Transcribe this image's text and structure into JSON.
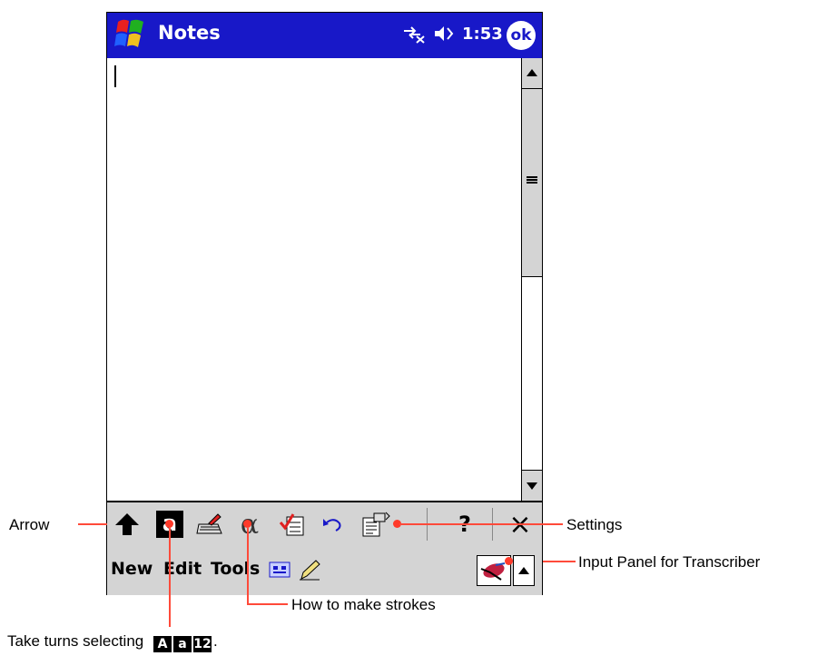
{
  "window": {
    "title": "Notes",
    "time": "1:53",
    "ok_label": "ok"
  },
  "transcriber_toolbar": {
    "tools": [
      {
        "name": "arrow",
        "icon": "up-arrow-icon"
      },
      {
        "name": "recognition-mode",
        "icon": "letter-a-icon",
        "glyph": "a"
      },
      {
        "name": "keyboard",
        "icon": "keyboard-icon"
      },
      {
        "name": "how-to-make-strokes",
        "icon": "alpha-icon",
        "glyph": "α"
      },
      {
        "name": "check",
        "icon": "checklist-icon"
      },
      {
        "name": "undo",
        "icon": "undo-icon"
      },
      {
        "name": "settings",
        "icon": "settings-icon"
      },
      {
        "name": "help",
        "icon": "question-icon",
        "glyph": "?"
      },
      {
        "name": "close",
        "icon": "close-icon",
        "glyph": "×"
      }
    ]
  },
  "menubar": {
    "new_label": "New",
    "edit_label": "Edit",
    "tools_label": "Tools"
  },
  "callouts": {
    "arrow": "Arrow",
    "settings": "Settings",
    "input_panel": "Input Panel for Transcriber",
    "strokes": "How to make strokes",
    "take_turns": "Take turns selecting",
    "take_turns_period": ".",
    "mode_glyphs": [
      "A",
      "a",
      "12"
    ]
  },
  "colors": {
    "title_bar": "#1818c8",
    "callout": "#ff4a3a"
  }
}
